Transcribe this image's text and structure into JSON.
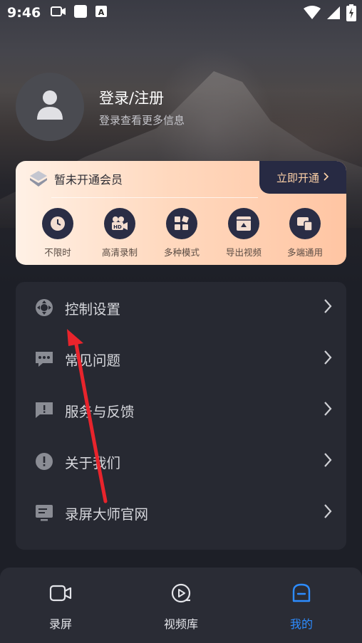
{
  "status_bar": {
    "time": "9:46",
    "icons": [
      "video-camera-icon",
      "white-square-icon",
      "a-notification-icon",
      "wifi-icon",
      "signal-icon",
      "battery-charging-icon"
    ]
  },
  "profile": {
    "title": "登录/注册",
    "subtitle": "登录查看更多信息",
    "avatar_icon": "user-icon"
  },
  "vip": {
    "status": "暂未开通会员",
    "open_button": "立即开通",
    "features": [
      {
        "label": "不限时",
        "icon": "clock-icon"
      },
      {
        "label": "高清录制",
        "icon": "hd-camera-icon"
      },
      {
        "label": "多种模式",
        "icon": "grid-icon"
      },
      {
        "label": "导出视频",
        "icon": "export-video-icon"
      },
      {
        "label": "多端通用",
        "icon": "multi-device-icon"
      }
    ],
    "accent_color": "#272a43"
  },
  "menu": {
    "items": [
      {
        "label": "控制设置",
        "icon": "control-settings-icon"
      },
      {
        "label": "常见问题",
        "icon": "chat-dots-icon"
      },
      {
        "label": "服务与反馈",
        "icon": "feedback-icon"
      },
      {
        "label": "关于我们",
        "icon": "info-exclamation-icon"
      },
      {
        "label": "录屏大师官网",
        "icon": "website-icon"
      }
    ]
  },
  "bottom_nav": {
    "items": [
      {
        "label": "录屏",
        "icon": "record-camera-icon",
        "active": false
      },
      {
        "label": "视频库",
        "icon": "video-library-icon",
        "active": false
      },
      {
        "label": "我的",
        "icon": "profile-tab-icon",
        "active": true
      }
    ],
    "active_color": "#2d8cff"
  },
  "annotation": {
    "arrow_color": "#e8242c"
  }
}
